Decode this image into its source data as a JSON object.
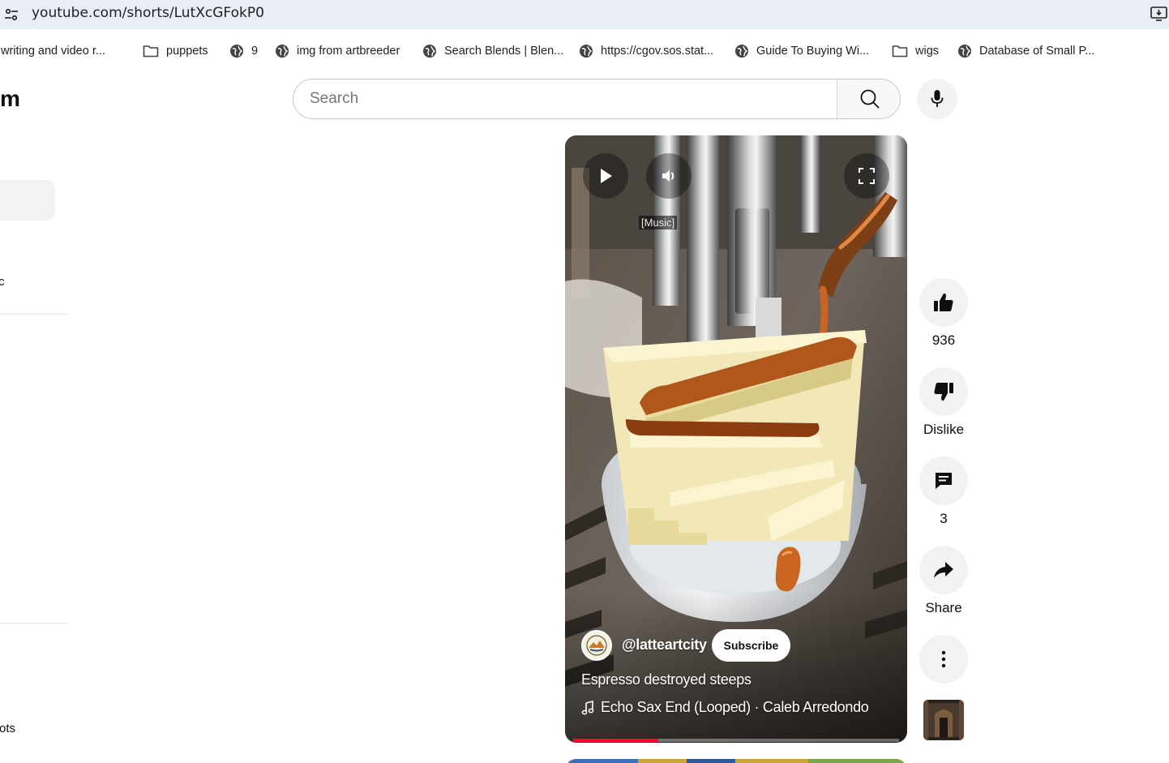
{
  "browser": {
    "url": "youtube.com/shorts/LutXcGFokP0",
    "icons": {
      "site": "tune-icon",
      "install": "install-app-icon"
    }
  },
  "bookmarks": [
    {
      "label": "writing and video r...",
      "icon": "globe-icon"
    },
    {
      "label": "puppets",
      "icon": "folder-icon"
    },
    {
      "label": "9",
      "icon": "globe-icon"
    },
    {
      "label": "img from artbreeder",
      "icon": "globe-icon"
    },
    {
      "label": "Search Blends | Blen...",
      "icon": "globe-icon"
    },
    {
      "label": "https://cgov.sos.stat...",
      "icon": "globe-icon"
    },
    {
      "label": "Guide To Buying Wi...",
      "icon": "globe-icon"
    },
    {
      "label": "wigs",
      "icon": "folder-icon"
    },
    {
      "label": "Database of Small P...",
      "icon": "globe-icon"
    }
  ],
  "sidebar": {
    "logo_fragment": "m",
    "item_fragment_1": "c",
    "item_fragment_2": "ots"
  },
  "search": {
    "placeholder": "Search"
  },
  "video": {
    "caption": "[Music]",
    "channel": "@latteartcity",
    "subscribe_label": "Subscribe",
    "title": "Espresso destroyed steeps",
    "music": "Echo Sax End (Looped) · Caleb Arredondo",
    "progress": 0.26
  },
  "actions": {
    "like_count": "936",
    "dislike_label": "Dislike",
    "comment_count": "3",
    "share_label": "Share"
  },
  "colors": {
    "accent_red": "#ff0033",
    "button_bg": "#f2f2f2",
    "address_bar_bg": "#e9eef6"
  }
}
